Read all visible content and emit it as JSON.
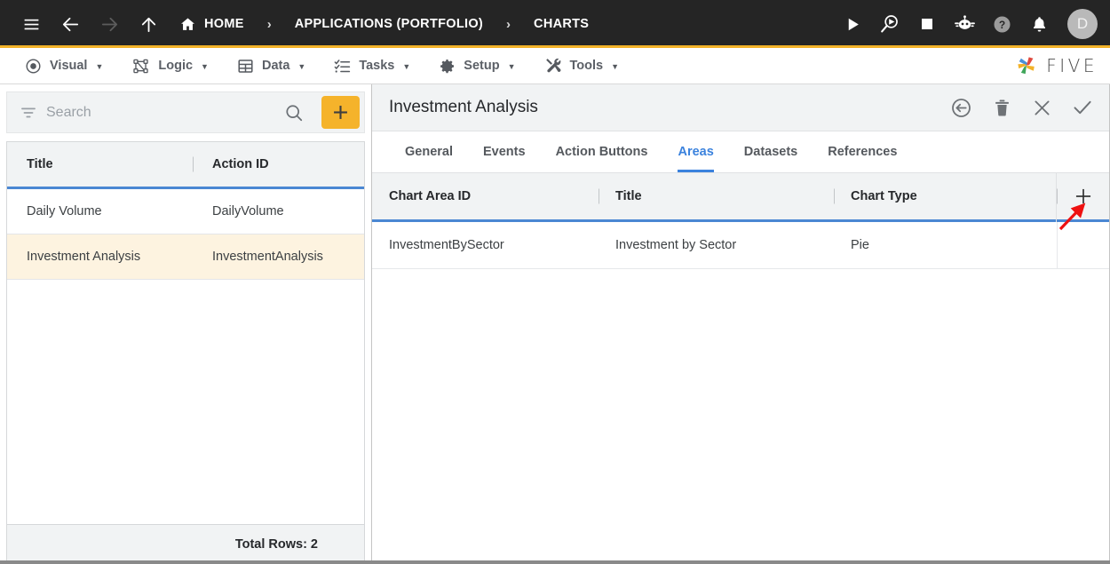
{
  "topbar": {
    "icons": {
      "menu": "hamburger-icon",
      "back": "back-arrow-icon",
      "forward": "forward-arrow-icon",
      "up": "up-arrow-icon"
    },
    "breadcrumb": [
      {
        "label": "HOME",
        "icon": "home-icon"
      },
      {
        "label": "APPLICATIONS (PORTFOLIO)",
        "icon": ""
      },
      {
        "label": "CHARTS",
        "icon": ""
      }
    ],
    "separator": "›",
    "right_icons": [
      "run-icon",
      "debug-icon",
      "stop-icon",
      "bot-icon",
      "help-icon",
      "bell-icon"
    ],
    "avatar_initial": "D"
  },
  "menubar": {
    "items": [
      {
        "label": "Visual",
        "icon": "eye-icon"
      },
      {
        "label": "Logic",
        "icon": "flow-icon"
      },
      {
        "label": "Data",
        "icon": "table-icon"
      },
      {
        "label": "Tasks",
        "icon": "checklist-icon"
      },
      {
        "label": "Setup",
        "icon": "gear-icon"
      },
      {
        "label": "Tools",
        "icon": "tools-icon"
      }
    ],
    "caret": "▼",
    "logo_text": "FIVE"
  },
  "left_panel": {
    "search": {
      "placeholder": "Search",
      "value": "",
      "filter_icon": "filter-icon",
      "search_icon": "search-icon",
      "add_label": "+"
    },
    "columns": [
      "Title",
      "Action ID"
    ],
    "rows": [
      {
        "title": "Daily Volume",
        "action_id": "DailyVolume",
        "selected": false
      },
      {
        "title": "Investment Analysis",
        "action_id": "InvestmentAnalysis",
        "selected": true
      }
    ],
    "footer": "Total Rows: 2"
  },
  "right_panel": {
    "title": "Investment Analysis",
    "actions": [
      {
        "name": "revert-icon",
        "glyph": "back-circle"
      },
      {
        "name": "delete-icon",
        "glyph": "trash"
      },
      {
        "name": "close-icon",
        "glyph": "x"
      },
      {
        "name": "save-icon",
        "glyph": "check"
      }
    ],
    "tabs": [
      {
        "label": "General",
        "active": false
      },
      {
        "label": "Events",
        "active": false
      },
      {
        "label": "Action Buttons",
        "active": false
      },
      {
        "label": "Areas",
        "active": true
      },
      {
        "label": "Datasets",
        "active": false
      },
      {
        "label": "References",
        "active": false
      }
    ],
    "table": {
      "columns": [
        "Chart Area ID",
        "Title",
        "Chart Type"
      ],
      "add_label": "+",
      "rows": [
        {
          "chart_area_id": "InvestmentBySector",
          "title": "Investment by Sector",
          "chart_type": "Pie"
        }
      ]
    }
  },
  "annotation": {
    "arrow_color": "#EE1111",
    "points_to": "add-chart-area-button"
  },
  "colors": {
    "topbar_bg": "#252525",
    "accent_yellow": "#F2B229",
    "add_button": "#F5B32B",
    "table_header_rule": "#4a87d3",
    "active_tab": "#3b82dd",
    "selected_row": "#FDF3E0"
  }
}
